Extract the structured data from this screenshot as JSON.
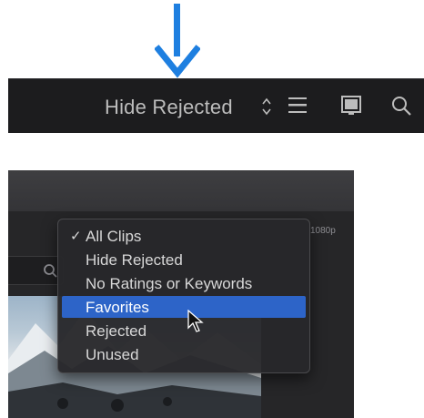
{
  "toolbar": {
    "filter_label": "Hide Rejected",
    "icons": [
      "up-down-chevron-icon",
      "list-view-icon",
      "filmstrip-icon",
      "search-icon"
    ]
  },
  "menu": {
    "items": [
      {
        "label": "All Clips",
        "checked": true,
        "highlighted": false
      },
      {
        "label": "Hide Rejected",
        "checked": false,
        "highlighted": false
      },
      {
        "label": "No Ratings or Keywords",
        "checked": false,
        "highlighted": false
      },
      {
        "label": "Favorites",
        "checked": false,
        "highlighted": true
      },
      {
        "label": "Rejected",
        "checked": false,
        "highlighted": false
      },
      {
        "label": "Unused",
        "checked": false,
        "highlighted": false
      }
    ],
    "check_glyph": "✓"
  },
  "browser": {
    "resolution_label": "1080p"
  },
  "colors": {
    "arrow": "#1e7fe0",
    "toolbar_bg": "#1c1c1e",
    "highlight": "#2d64c8"
  }
}
